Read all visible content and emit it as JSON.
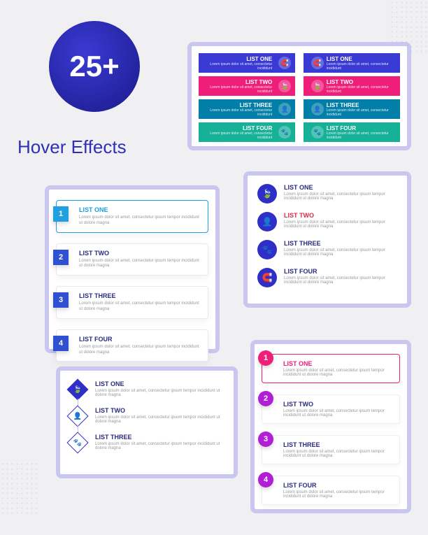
{
  "hero": {
    "badge": "25+",
    "subtitle": "Hover Effects"
  },
  "lorem": "Lorem ipsum dolor sit amet, consectetur ipsum tempor incididunt ut dolore magna",
  "lorem_short": "Lorem ipsum dolor sit amet, consectetur incididunt",
  "panel1": {
    "items": [
      {
        "title": "LIST ONE"
      },
      {
        "title": "LIST TWO"
      },
      {
        "title": "LIST THREE"
      },
      {
        "title": "LIST FOUR"
      }
    ]
  },
  "panel2": {
    "items": [
      {
        "num": "1",
        "title": "LIST ONE"
      },
      {
        "num": "2",
        "title": "LIST TWO"
      },
      {
        "num": "3",
        "title": "LIST THREE"
      },
      {
        "num": "4",
        "title": "LIST FOUR"
      }
    ]
  },
  "panel3": {
    "items": [
      {
        "icon": "🍃",
        "title": "LIST ONE"
      },
      {
        "icon": "👤",
        "title": "LIST TWO"
      },
      {
        "icon": "🐾",
        "title": "LIST THREE"
      },
      {
        "icon": "🧲",
        "title": "LIST FOUR"
      }
    ]
  },
  "panel4": {
    "items": [
      {
        "icon": "🍃",
        "title": "LIST ONE"
      },
      {
        "icon": "👤",
        "title": "LIST TWO"
      },
      {
        "icon": "🐾",
        "title": "LIST THREE"
      }
    ]
  },
  "panel5": {
    "items": [
      {
        "num": "1",
        "title": "LIST ONE"
      },
      {
        "num": "2",
        "title": "LIST TWO"
      },
      {
        "num": "3",
        "title": "LIST THREE"
      },
      {
        "num": "4",
        "title": "LIST FOUR"
      }
    ]
  }
}
